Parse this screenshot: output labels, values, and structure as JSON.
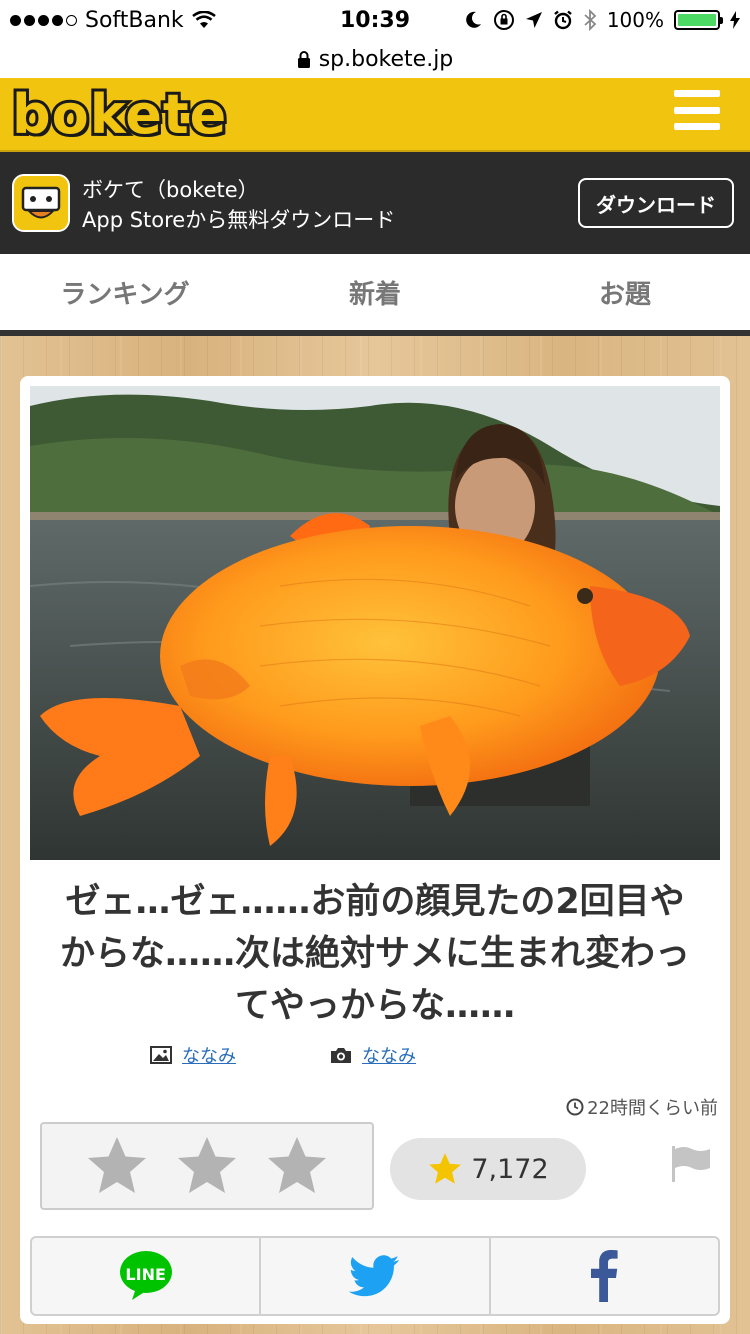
{
  "status_bar": {
    "carrier": "SoftBank",
    "time": "10:39",
    "battery_percent": "100%",
    "battery_level": 1.0
  },
  "browser": {
    "url": "sp.bokete.jp"
  },
  "header": {
    "logo_text": "bokete",
    "menu_icon": "hamburger-icon"
  },
  "app_banner": {
    "title": "ボケて（bokete）",
    "subtitle": "App Storeから無料ダウンロード",
    "download_label": "ダウンロード"
  },
  "tabs": [
    {
      "label": "ランキング"
    },
    {
      "label": "新着"
    },
    {
      "label": "お題"
    }
  ],
  "post": {
    "photo_icon": "goldfish-photo",
    "caption": "ゼェ…ゼェ……お前の顔見たの2回目やからな……次は絶対サメに生まれ変わってやっからな……",
    "image_credit": "ななみ",
    "photo_credit": "ななみ",
    "timestamp": "22時間くらい前",
    "score": "7,172",
    "rating_stars": 3
  },
  "share": {
    "line_label": "LINE",
    "twitter_icon": "twitter-icon",
    "facebook_icon": "facebook-icon"
  },
  "colors": {
    "header_yellow": "#f1c40f",
    "banner_dark": "#2b2b2b",
    "link_blue": "#2a6ebb",
    "line_green": "#00c300",
    "twitter_blue": "#1da1f2",
    "facebook_blue": "#3b5998"
  }
}
